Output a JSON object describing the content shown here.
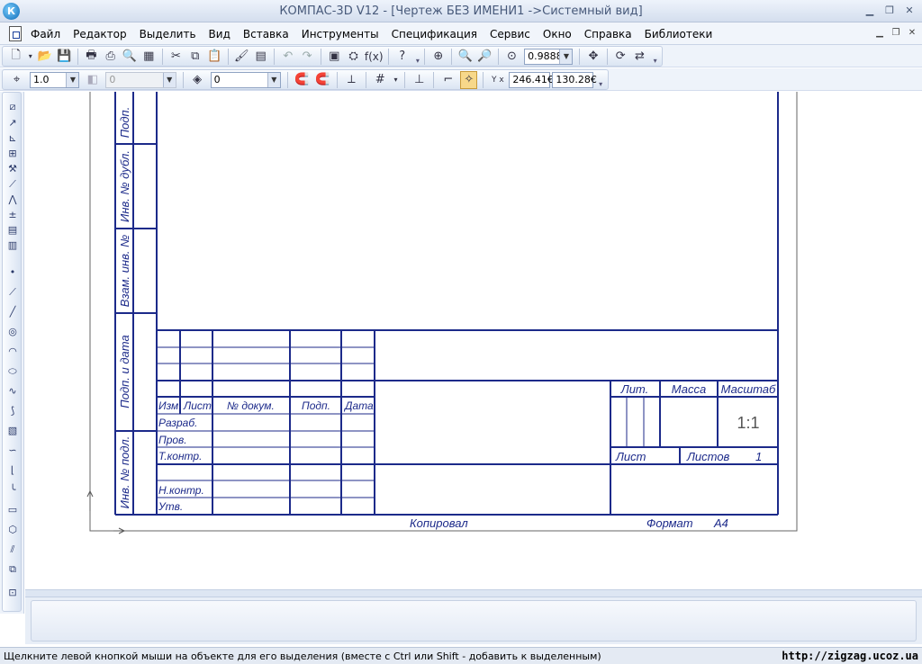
{
  "window": {
    "app_icon_letter": "К",
    "title": "КОМПАС-3D V12 - [Чертеж БЕЗ ИМЕНИ1 ->Системный вид]"
  },
  "menu": {
    "items": [
      "Файл",
      "Редактор",
      "Выделить",
      "Вид",
      "Вставка",
      "Инструменты",
      "Спецификация",
      "Сервис",
      "Окно",
      "Справка",
      "Библиотеки"
    ]
  },
  "toolbar_standard": {
    "zoom_value": "0.9888"
  },
  "toolbar_current_state": {
    "line_step": "1.0",
    "angle_step": "0",
    "layer": "0",
    "cursor_x": "246.41€",
    "cursor_y": "130.28€",
    "cursor_label": "Y x"
  },
  "drawing": {
    "side_labels": [
      "Подп.",
      "Инв. № дубл.",
      "Взам. инв. №",
      "Подп. и дата",
      "Инв. № подл."
    ],
    "headers": [
      "Изм.",
      "Лист",
      "№ докум.",
      "Подп.",
      "Дата"
    ],
    "rows": [
      "Разраб.",
      "Пров.",
      "Т.контр.",
      "",
      "Н.контр.",
      "Утв."
    ],
    "lit_label": "Лит.",
    "mass_label": "Масса",
    "scale_label": "Масштаб",
    "scale_value": "1:1",
    "sheet_label": "Лист",
    "sheets_label": "Листов",
    "sheets_count": "1",
    "copied_label": "Копировал",
    "format_label": "Формат",
    "format_value": "А4"
  },
  "status": {
    "message": "Щелкните левой кнопкой мыши на объекте для его выделения (вместе с Ctrl или Shift - добавить к выделенным)",
    "watermark": "http://zigzag.ucoz.ua"
  }
}
